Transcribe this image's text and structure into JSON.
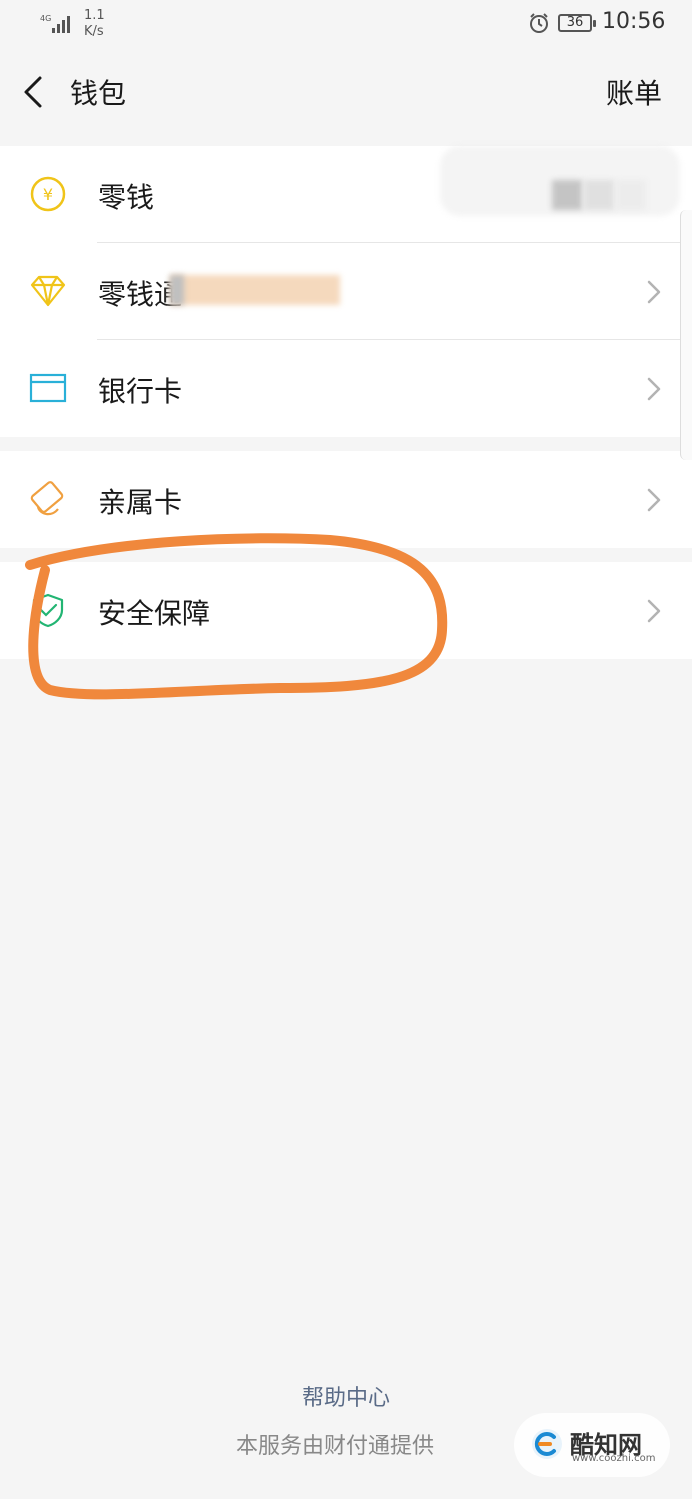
{
  "status_bar": {
    "network": "4G",
    "speed_value": "1.1",
    "speed_unit": "K/s",
    "battery": "36",
    "time": "10:56"
  },
  "header": {
    "title": "钱包",
    "right_action": "账单"
  },
  "groups": [
    {
      "items": [
        {
          "label": "零钱",
          "icon": "yuan-coin-icon",
          "color": "#f0c419"
        },
        {
          "label": "零钱通",
          "icon": "diamond-icon",
          "color": "#f0c419"
        },
        {
          "label": "银行卡",
          "icon": "bank-card-icon",
          "color": "#29b0d8"
        }
      ]
    },
    {
      "items": [
        {
          "label": "亲属卡",
          "icon": "family-card-icon",
          "color": "#f0a040"
        }
      ]
    },
    {
      "items": [
        {
          "label": "安全保障",
          "icon": "shield-icon",
          "color": "#22b573"
        }
      ]
    }
  ],
  "footer": {
    "help": "帮助中心",
    "provider": "本服务由财付通提供"
  },
  "watermark": {
    "title": "酷知网",
    "subtitle": "www.coozhi.com"
  },
  "annotation_color": "#f0883c"
}
